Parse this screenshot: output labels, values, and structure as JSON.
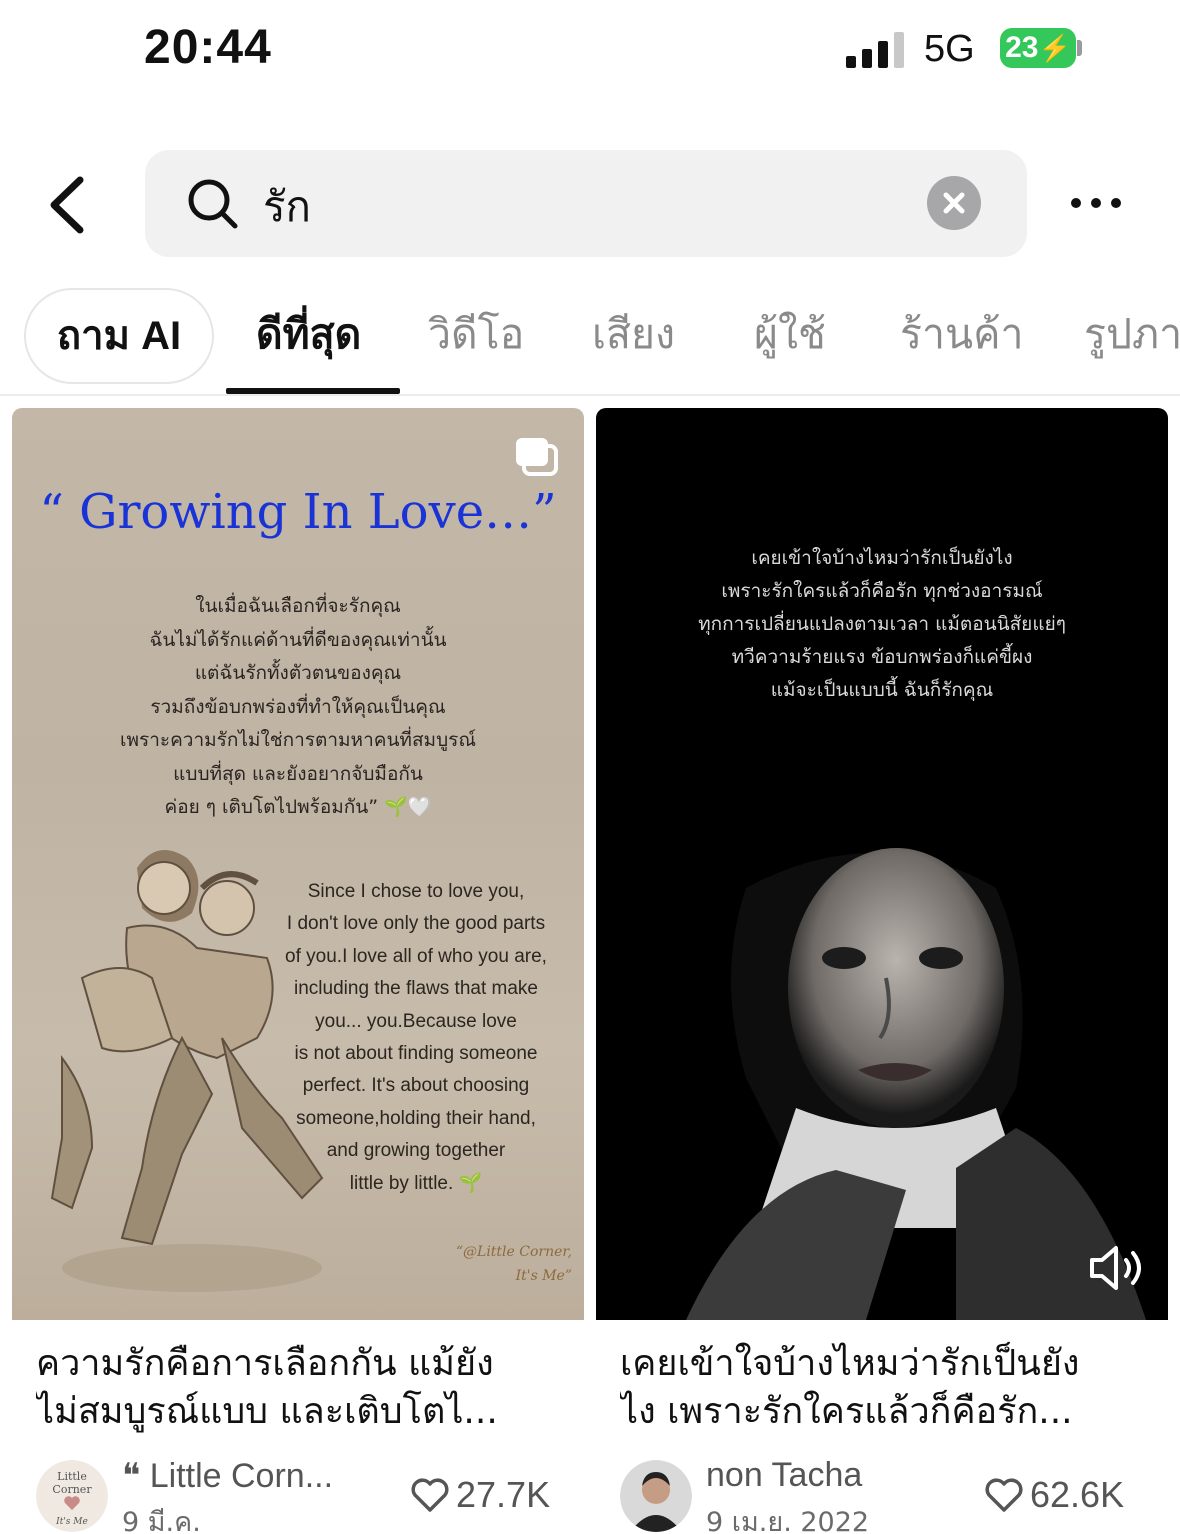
{
  "status_bar": {
    "time": "20:44",
    "network": "5G",
    "battery": "23"
  },
  "search": {
    "query": "รัก"
  },
  "tabs": {
    "ask_ai": "ถาม AI",
    "items": [
      "ดีที่สุด",
      "วิดีโอ",
      "เสียง",
      "ผู้ใช้",
      "ร้านค้า",
      "รูปภาพ"
    ],
    "active_index": 0
  },
  "results": [
    {
      "thumbnail": {
        "title": "“ Growing In Love…”",
        "thai_lines": [
          "ในเมื่อฉันเลือกที่จะรักคุณ",
          "ฉันไม่ได้รักแค่ด้านที่ดีของคุณเท่านั้น",
          "แต่ฉันรักทั้งตัวตนของคุณ",
          "รวมถึงข้อบกพร่องที่ทำให้คุณเป็นคุณ",
          "เพราะความรักไม่ใช่การตามหาคนที่สมบูรณ์",
          "แบบที่สุด และยังอยากจับมือกัน",
          "ค่อย ๆ เติบโตไปพร้อมกัน” 🌱🤍"
        ],
        "english_lines": [
          "Since I chose to love you,",
          "I don't love only the good parts",
          "of you.I love all of who you are,",
          "including the flaws that make",
          "you... you.Because love",
          "is not about finding someone",
          "perfect. It's about choosing",
          "someone,holding their hand,",
          "and growing together",
          "little by little. 🌱"
        ],
        "credit_lines": [
          "“@Little Corner,",
          "It's Me”"
        ]
      },
      "title_lines": [
        "ความรักคือการเลือกกัน แม้ยัง",
        "ไม่สมบูรณ์แบบ และเติบโตไ..."
      ],
      "author": "❝ Little Corn...",
      "avatar_text": [
        "Little",
        "Corner",
        "It's Me"
      ],
      "date": "9 มี.ค.",
      "likes": "27.7K",
      "badge_icon": "multi-image-icon"
    },
    {
      "thumbnail": {
        "thai_lines": [
          "เคยเข้าใจบ้างไหมว่ารักเป็นยังไง",
          "เพราะรักใครแล้วก็คือรัก ทุกช่วงอารมณ์",
          "ทุกการเปลี่ยนแปลงตามเวลา แม้ตอนนิสัยแย่ๆ",
          "ทวีความร้ายแรง ข้อบกพร่องก็แค่ขี้ผง",
          "แม้จะเป็นแบบนี้ ฉันก็รักคุณ"
        ]
      },
      "title_lines": [
        "เคยเข้าใจบ้างไหมว่ารักเป็นยัง",
        "ไง เพราะรักใครแล้วก็คือรัก..."
      ],
      "author": "non Tacha",
      "date": "9 เม.ย. 2022",
      "likes": "62.6K",
      "badge_icon": "speaker-icon"
    }
  ],
  "colors": {
    "accent_blue": "#1a33d6",
    "battery_green": "#34c759",
    "search_bg": "#f1f1f2"
  }
}
